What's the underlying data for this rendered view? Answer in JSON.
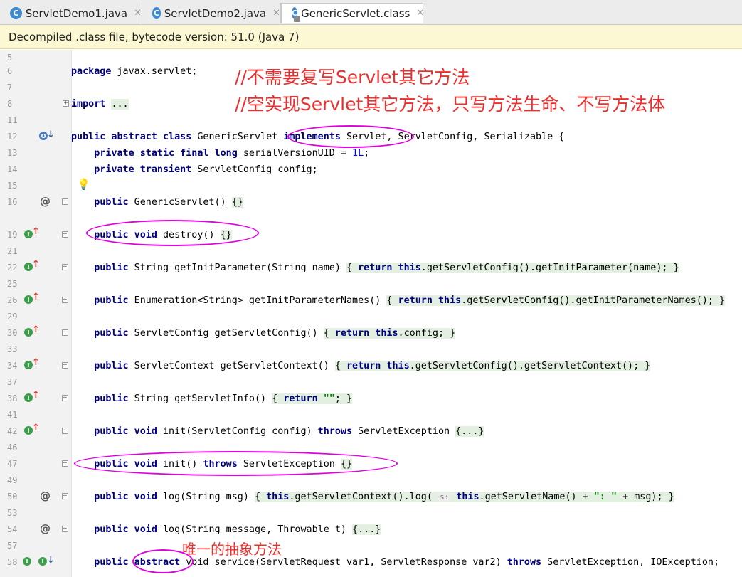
{
  "tabs": [
    {
      "label": "ServletDemo1.java",
      "icon": "class-icon",
      "active": false
    },
    {
      "label": "ServletDemo2.java",
      "icon": "class-icon",
      "active": false
    },
    {
      "label": "GenericServlet.class",
      "icon": "class-icon",
      "active": true
    }
  ],
  "banner": {
    "text": "Decompiled .class file, bytecode version: 51.0 (Java 7)"
  },
  "annotations": {
    "note1": "//不需要复写Servlet其它方法",
    "note2": "//空实现Servlet其它方法，只写方法生命、不写方法体",
    "note3": "唯一的抽象方法"
  },
  "code": {
    "l5": "5",
    "l6": "6",
    "l7": "7",
    "l8": "8",
    "l11": "11",
    "l12": "12",
    "l13": "13",
    "l14": "14",
    "l15": "15",
    "l16": "16",
    "l19": "19",
    "l21": "21",
    "l22": "22",
    "l25": "25",
    "l26": "26",
    "l29": "29",
    "l30": "30",
    "l33": "33",
    "l34": "34",
    "l37": "37",
    "l38": "38",
    "l41": "41",
    "l42": "42",
    "l46": "46",
    "l47": "47",
    "l49": "49",
    "l50": "50",
    "l53": "53",
    "l54": "54",
    "l57": "57",
    "l58": "58"
  },
  "colors": {
    "keyword": "#000080",
    "number": "#0000ff",
    "string": "#008000",
    "annotation_text": "#ef2d2d",
    "annotation_ellipse": "#e100e1",
    "banner_bg": "#fcf8d3",
    "override_icon": "#3c9f4a"
  }
}
